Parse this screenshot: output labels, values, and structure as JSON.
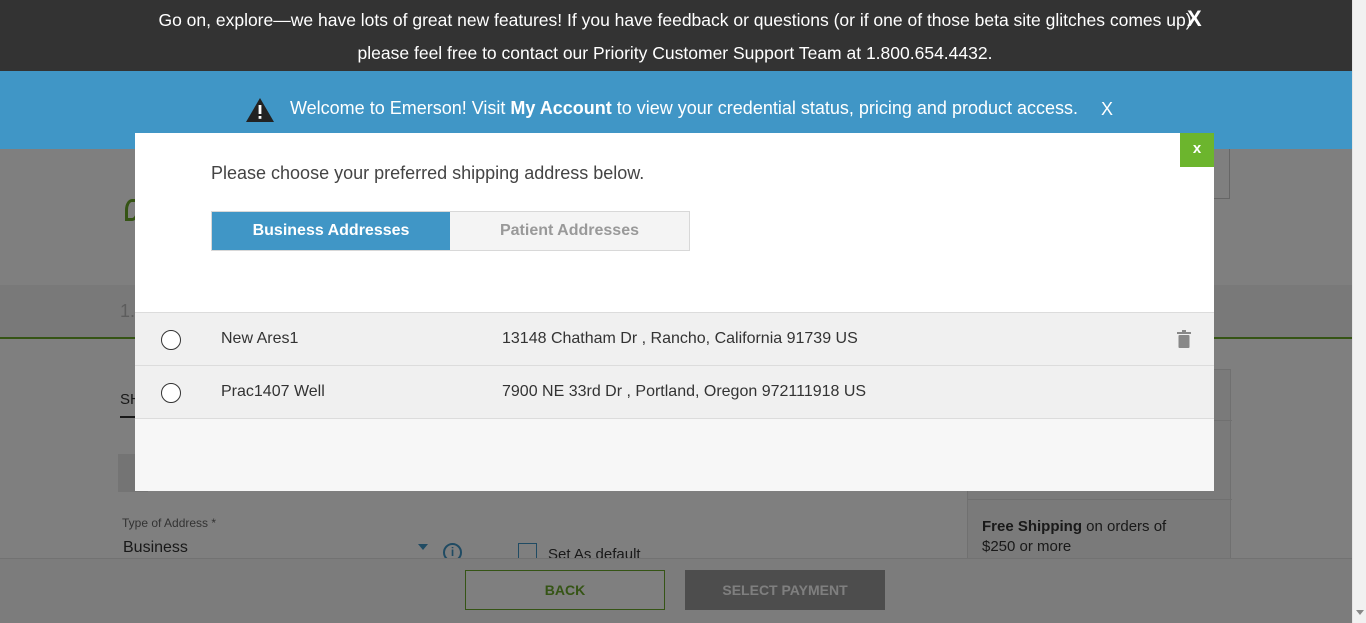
{
  "top_banner": {
    "message": "Go on, explore—we have lots of great new features! If you have feedback or questions (or if one of those beta site glitches comes up) please feel free to contact our Priority Customer Support Team at 1.800.654.4432.",
    "close_label": "X"
  },
  "welcome_bar": {
    "text_before": "Welcome to Emerson! Visit ",
    "link_text": "My Account",
    "text_after": " to view your credential status, pricing and product access.",
    "close_label": "X",
    "icon": "warning-icon"
  },
  "page": {
    "step_number": "1.",
    "ship_tab_label": "SH",
    "type_of_address_label": "Type of Address *",
    "type_of_address_value": "Business",
    "set_default_label": "Set As default",
    "shipping_bold": "Free Shipping",
    "shipping_rest": " on orders of $250 or more",
    "back_button": "BACK",
    "select_payment_button": "SELECT PAYMENT"
  },
  "modal": {
    "close_label": "x",
    "title": "Please choose your preferred shipping address below.",
    "tabs": [
      {
        "label": "Business Addresses",
        "active": true
      },
      {
        "label": "Patient Addresses",
        "active": false
      }
    ],
    "addresses": [
      {
        "name": "New Ares1",
        "address": "13148 Chatham Dr , Rancho, California 91739 US",
        "deletable": true
      },
      {
        "name": "Prac1407 Well",
        "address": "7900 NE 33rd Dr , Portland, Oregon 972111918 US",
        "deletable": false
      }
    ]
  },
  "colors": {
    "accent_blue": "#4096c6",
    "brand_green": "#6cb52d",
    "dark_banner": "#333333"
  }
}
